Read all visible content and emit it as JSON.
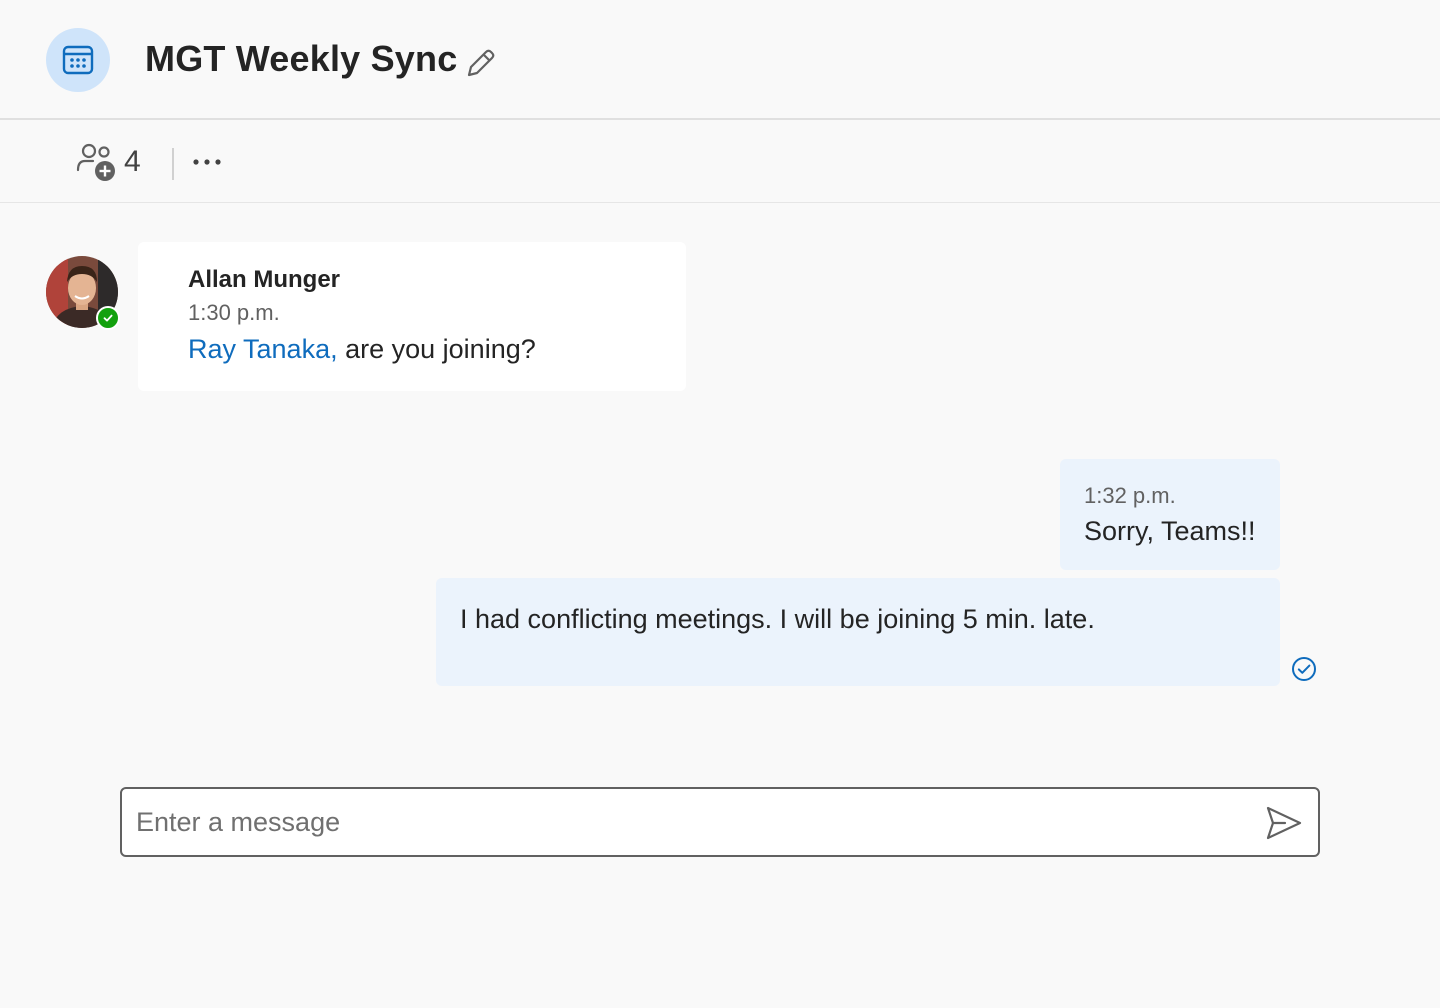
{
  "header": {
    "title": "MGT Weekly Sync",
    "meeting_icon": "calendar-icon",
    "edit_icon": "pencil-icon"
  },
  "toolbar": {
    "participants_icon": "people-add-icon",
    "participants_count": "4",
    "more_icon": "more-horizontal-icon"
  },
  "messages": [
    {
      "author": "Allan Munger",
      "time": "1:30 p.m.",
      "mention": "Ray Tanaka,",
      "text": " are you joining?",
      "presence": "available"
    },
    {
      "time": "1:32 p.m.",
      "text": "Sorry, Teams!!"
    },
    {
      "text": "I had conflicting meetings. I will be joining 5 min. late.",
      "status_icon": "read-receipt-icon"
    }
  ],
  "composer": {
    "placeholder": "Enter a message",
    "value": "",
    "send_icon": "send-icon"
  },
  "colors": {
    "accent": "#0f6cbd",
    "presence_available": "#13a10e",
    "outgoing_bubble": "#ebf3fc",
    "incoming_bubble": "#ffffff",
    "meeting_icon_bg": "#cfe4fa"
  }
}
